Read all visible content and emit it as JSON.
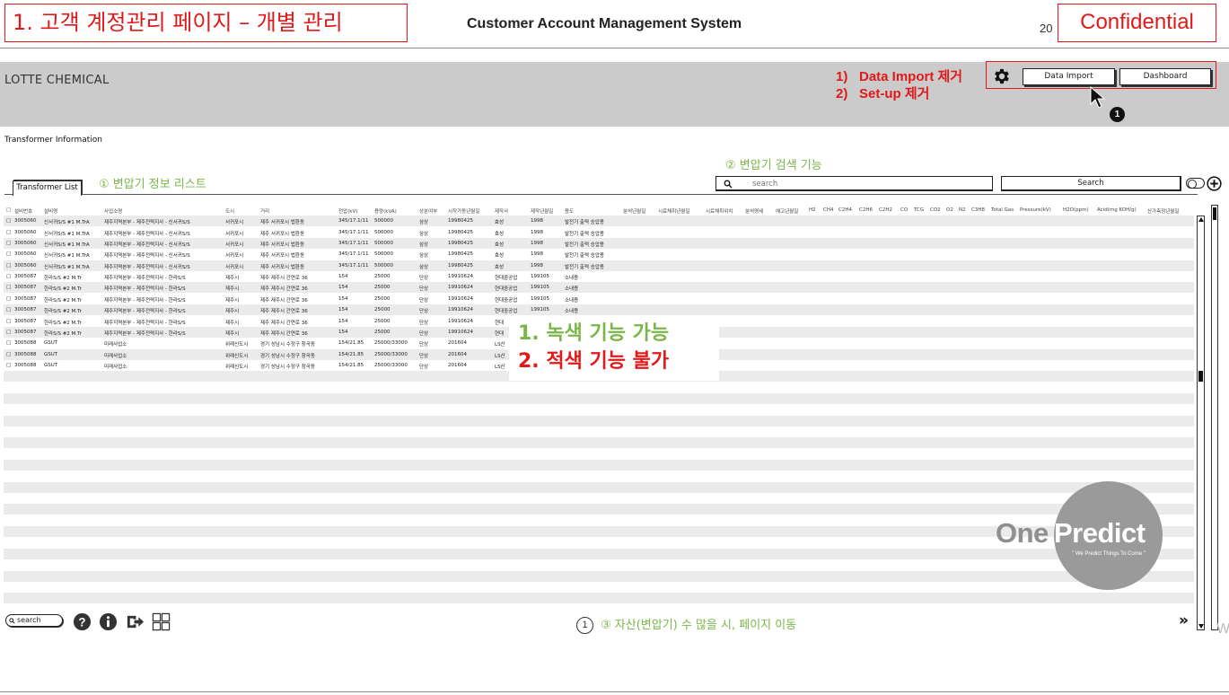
{
  "slide": {
    "title": "1. 고객 계정관리 페이지 – 개별 관리",
    "system_title": "Customer Account Management System",
    "page_number": "20",
    "confidential": "Confidential"
  },
  "header": {
    "brand": "LOTTE CHEMICAL",
    "notes": [
      {
        "num": "1)",
        "text": "Data Import 제거"
      },
      {
        "num": "2)",
        "text": "Set-up 제거"
      }
    ],
    "settings_icon": "gear-icon",
    "data_import_label": "Data Import",
    "dashboard_label": "Dashboard",
    "badge": "1"
  },
  "section": {
    "label": "Transformer Information",
    "tab_label": "Transformer List",
    "annotation_list": "① 변압기 정보 리스트",
    "annotation_search": "② 변압기 검색 기능",
    "search_placeholder": "search",
    "search_button": "Search"
  },
  "table": {
    "columns": [
      "설비번호",
      "설비명",
      "사업소명",
      "도시",
      "거리",
      "전압(kV)",
      "용량(kVA)",
      "상분여부",
      "시작가동년월일",
      "제작사",
      "제작년월일",
      "용도",
      "분석년월일",
      "시료채취년월일",
      "시료채취위치",
      "분석명세",
      "예고년월일",
      "H2",
      "CH4",
      "C2H4",
      "C2H6",
      "C2H2",
      "CO",
      "TCG",
      "CO2",
      "O2",
      "N2",
      "C3H8",
      "Total Gas",
      "Pressure(kV)",
      "H2O(ppm)",
      "Acid(mg KOH/g)",
      "산가측정년월일"
    ],
    "rows": [
      [
        "3005060",
        "신서귀S/S #1 M.TrA",
        "제주지역본부 - 제주전력지사 - 신서귀S/S",
        "서귀포시",
        "제주 서귀포시 법환동",
        "345/17.1/11",
        "500000",
        "삼상",
        "19980425",
        "효성",
        "1998",
        "발전기 출력 승압용"
      ],
      [
        "3005060",
        "신서귀S/S #1 M.TrA",
        "제주지역본부 - 제주전력지사 - 신서귀S/S",
        "서귀포시",
        "제주 서귀포시 법환동",
        "345/17.1/11",
        "500000",
        "삼상",
        "19980425",
        "효성",
        "1998",
        "발전기 출력 승압용"
      ],
      [
        "3005060",
        "신서귀S/S #1 M.TrA",
        "제주지역본부 - 제주전력지사 - 신서귀S/S",
        "서귀포시",
        "제주 서귀포시 법환동",
        "345/17.1/11",
        "500000",
        "삼상",
        "19980425",
        "효성",
        "1998",
        "발전기 출력 승압용"
      ],
      [
        "3005060",
        "신서귀S/S #1 M.TrA",
        "제주지역본부 - 제주전력지사 - 신서귀S/S",
        "서귀포시",
        "제주 서귀포시 법환동",
        "345/17.1/11",
        "500000",
        "삼상",
        "19980425",
        "효성",
        "1998",
        "발전기 출력 승압용"
      ],
      [
        "3005060",
        "신서귀S/S #1 M.TrA",
        "제주지역본부 - 제주전력지사 - 신서귀S/S",
        "서귀포시",
        "제주 서귀포시 법환동",
        "345/17.1/11",
        "500000",
        "삼상",
        "19980425",
        "효성",
        "1998",
        "발전기 출력 승압용"
      ],
      [
        "3005087",
        "한라S/S #2 M.Tr",
        "제주지역본부 - 제주전력지사 - 한라S/S",
        "제주시",
        "제주 제주시 간연로 36",
        "154",
        "25000",
        "단상",
        "19910624",
        "현대중공업",
        "199105",
        "소내용"
      ],
      [
        "3005087",
        "한라S/S #2 M.Tr",
        "제주지역본부 - 제주전력지사 - 한라S/S",
        "제주시",
        "제주 제주시 간연로 36",
        "154",
        "25000",
        "단상",
        "19910624",
        "현대중공업",
        "199105",
        "소내용"
      ],
      [
        "3005087",
        "한라S/S #2 M.Tr",
        "제주지역본부 - 제주전력지사 - 한라S/S",
        "제주시",
        "제주 제주시 간연로 36",
        "154",
        "25000",
        "단상",
        "19910624",
        "현대중공업",
        "199105",
        "소내용"
      ],
      [
        "3005087",
        "한라S/S #2 M.Tr",
        "제주지역본부 - 제주전력지사 - 한라S/S",
        "제주시",
        "제주 제주시 간연로 36",
        "154",
        "25000",
        "단상",
        "19910624",
        "현대중공업",
        "199105",
        "소내용"
      ],
      [
        "3005087",
        "한라S/S #2 M.Tr",
        "제주지역본부 - 제주전력지사 - 한라S/S",
        "제주시",
        "제주 제주시 간연로 36",
        "154",
        "25000",
        "단상",
        "19910624",
        "현대",
        "",
        ""
      ],
      [
        "3005087",
        "한라S/S #2 M.Tr",
        "제주지역본부 - 제주전력지사 - 한라S/S",
        "제주시",
        "제주 제주시 간연로 36",
        "154",
        "25000",
        "단상",
        "19910624",
        "현대",
        "",
        ""
      ],
      [
        "3005088",
        "GSUT",
        "미래사업소",
        "위례신도시",
        "경기 성남시 수정구 창곡동",
        "154/21.85",
        "25000/33000",
        "단상",
        "201604",
        "LS산",
        "",
        ""
      ],
      [
        "3005088",
        "GSUT",
        "미래사업소",
        "위례신도시",
        "경기 성남시 수정구 창곡동",
        "154/21.85",
        "25000/33000",
        "단상",
        "201604",
        "LS산",
        "",
        ""
      ],
      [
        "3005088",
        "GSUT",
        "미래사업소",
        "위례신도시",
        "경기 성남시 수정구 창곡동",
        "154/21.85",
        "25000/33000",
        "단상",
        "201604",
        "LS산",
        "",
        ""
      ]
    ]
  },
  "overlay_note": {
    "green": "1.  녹색 기능 가능",
    "red": "2.  적색 기능 불가"
  },
  "logo": {
    "one": "One",
    "predict": "Predict",
    "tagline": "\" We Predict Things To Come \""
  },
  "footer": {
    "search_label": "search",
    "icons": [
      "help-icon",
      "info-icon",
      "exit-icon",
      "grid-icon"
    ],
    "annotation_num": "1",
    "annotation_page": "③ 자산(변압기) 수 많을 시, 페이지 이동",
    "next_label": "»",
    "stray": "W"
  },
  "colors": {
    "red": "#e01a1a",
    "green": "#7ab648",
    "header_gray": "#cbcbcb",
    "stripe_gray": "#ebebeb"
  }
}
